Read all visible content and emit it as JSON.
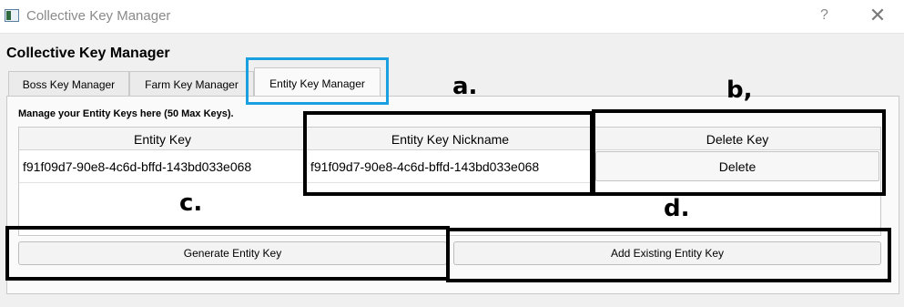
{
  "window": {
    "title": "Collective Key Manager",
    "help_label": "?",
    "close_label": "✕"
  },
  "dialog": {
    "heading": "Collective Key Manager",
    "tabs": [
      {
        "label": "Boss Key Manager",
        "active": false
      },
      {
        "label": "Farm Key Manager",
        "active": false
      },
      {
        "label": "Entity Key Manager",
        "active": true
      }
    ],
    "manage_label": "Manage your Entity Keys here (50 Max Keys).",
    "table": {
      "columns": [
        "Entity Key",
        "Entity Key Nickname",
        "Delete Key"
      ],
      "rows": [
        {
          "key": "f91f09d7-90e8-4c6d-bffd-143bd033e068",
          "nickname": "f91f09d7-90e8-4c6d-bffd-143bd033e068",
          "action": "Delete"
        }
      ]
    },
    "buttons": {
      "generate": "Generate Entity Key",
      "add_existing": "Add Existing Entity Key"
    }
  },
  "annotations": {
    "a": "a.",
    "b": "b,",
    "c": "c.",
    "d": "d."
  },
  "colors": {
    "highlight_tab": "#19a0e0",
    "annotation_box": "#000000"
  }
}
